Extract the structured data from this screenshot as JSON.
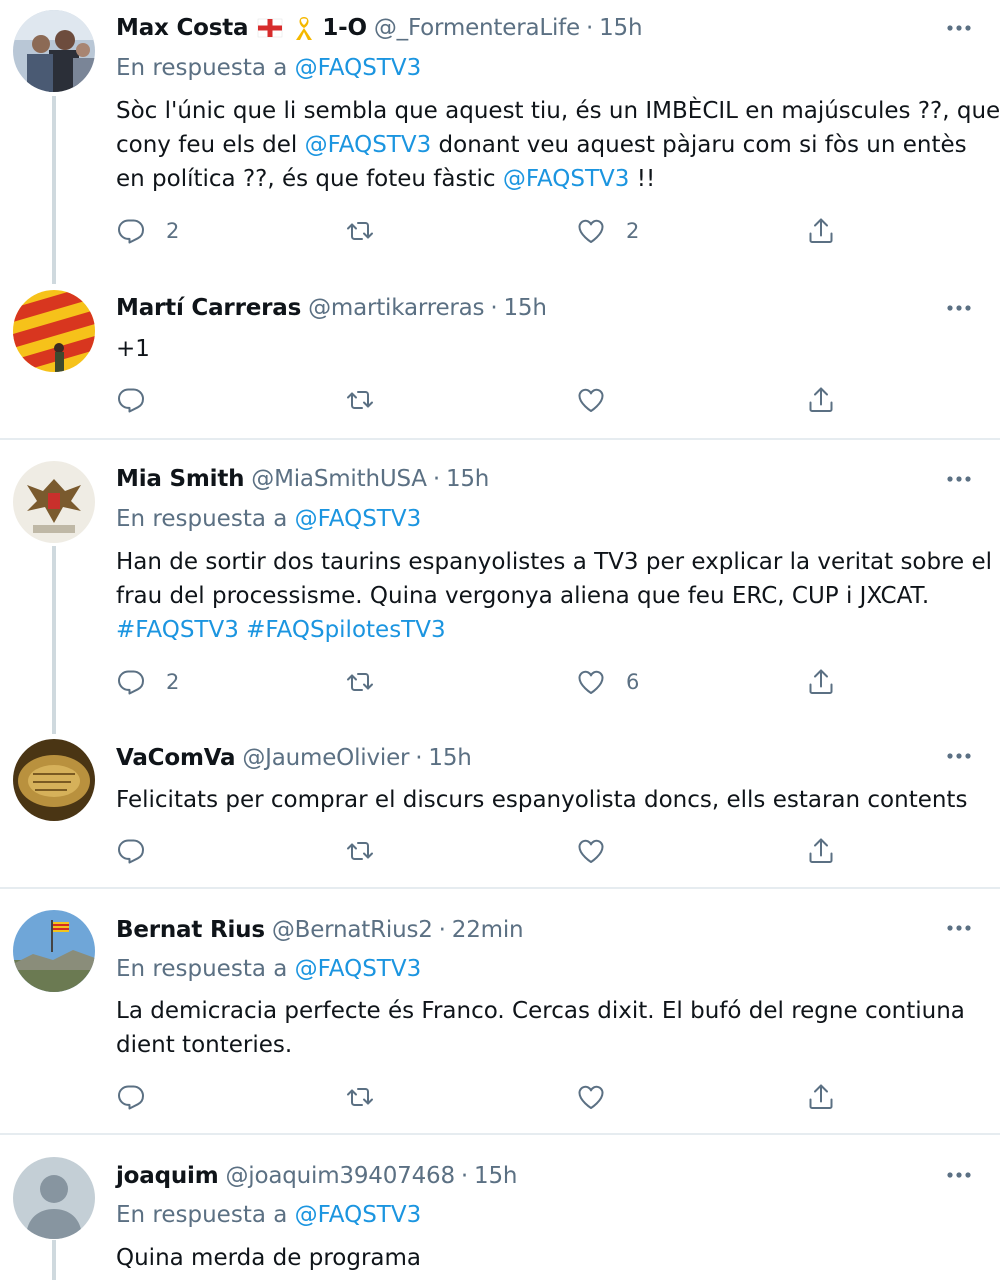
{
  "tweets": [
    {
      "name": "Max Costa",
      "badge_text": "1-O",
      "handle": "@_FormenteraLife",
      "time": "15h",
      "reply_prefix": "En respuesta a",
      "reply_to": "@FAQSTV3",
      "lines": [
        [
          "Sòc l'únic que li sembla que aquest tiu, és un IMBÈCIL en majúscules ??,  que"
        ],
        [
          "cony feu els del ",
          "@FAQSTV3",
          " donant veu aquest pàjaru com si fòs un entès"
        ],
        [
          "en política ??, és que foteu fàstic ",
          "@FAQSTV3",
          " !!"
        ]
      ],
      "replies": "2",
      "retweets": "",
      "likes": "2"
    },
    {
      "name": "Martí Carreras",
      "handle": "@martikarreras",
      "time": "15h",
      "lines": [
        [
          "+1"
        ]
      ],
      "replies": "",
      "retweets": "",
      "likes": ""
    },
    {
      "name": "Mia Smith",
      "handle": "@MiaSmithUSA",
      "time": "15h",
      "reply_prefix": "En respuesta a",
      "reply_to": "@FAQSTV3",
      "lines": [
        [
          "Han de sortir dos taurins espanyolistes a TV3 per explicar la veritat sobre el"
        ],
        [
          "frau del processisme. Quina vergonya aliena que feu ERC, CUP i JXCAT."
        ],
        [
          "",
          "#FAQSTV3 #FAQSpilotesTV3"
        ]
      ],
      "replies": "2",
      "retweets": "",
      "likes": "6"
    },
    {
      "name": "VaComVa",
      "handle": "@JaumeOlivier",
      "time": "15h",
      "lines": [
        [
          "Felicitats per comprar el discurs espanyolista doncs, ells estaran contents"
        ]
      ],
      "replies": "",
      "retweets": "",
      "likes": ""
    },
    {
      "name": "Bernat Rius",
      "handle": "@BernatRius2",
      "time": "22min",
      "reply_prefix": "En respuesta a",
      "reply_to": "@FAQSTV3",
      "lines": [
        [
          "La demicracia perfecte és Franco. Cercas dixit. El bufó del regne contiuna"
        ],
        [
          "dient tonteries."
        ]
      ],
      "replies": "",
      "retweets": "",
      "likes": ""
    },
    {
      "name": "joaquim",
      "handle": "@joaquim39407468",
      "time": "15h",
      "reply_prefix": "En respuesta a",
      "reply_to": "@FAQSTV3",
      "lines": [
        [
          "Quina merda de programa"
        ]
      ]
    }
  ],
  "icons": {
    "reply": "reply-icon",
    "retweet": "retweet-icon",
    "like": "heart-icon",
    "share": "share-icon",
    "more": "more-icon"
  },
  "colors": {
    "mention": "#1b95e0",
    "secondary": "#5b7083",
    "divider": "#e6ecf0",
    "thread_line": "#cfd9de"
  }
}
